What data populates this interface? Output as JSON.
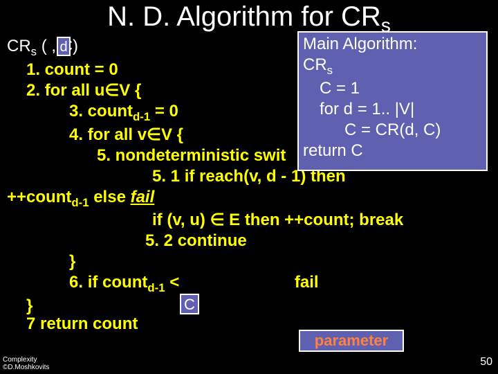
{
  "title": {
    "pre": "N. D. Algorithm for CR",
    "sub": "s"
  },
  "main_box": {
    "l1": "Main Algorithm:",
    "l2_pre": "CR",
    "l2_sub": "s",
    "l3": "C = 1",
    "l4": "for d = 1.. |V|",
    "l5": "C = CR(d, C)",
    "l6": "return C"
  },
  "box_d": "d",
  "box_c": "C",
  "box_param": "parameter",
  "code": {
    "l1_a": "CR",
    "l1_sub": "s",
    "l1_b": " (  , C)",
    "l2": "1. count = 0",
    "l3_a": "2. ",
    "l3_b": "for all",
    "l3_c": "  u",
    "l3_d": "V {",
    "l4_a": "3. count",
    "l4_sub": "d-1",
    "l4_b": " = 0",
    "l5_a": "4. ",
    "l5_b": "for all",
    "l5_c": "  v",
    "l5_d": "V {",
    "l6": "5. nondeterministic swit",
    "l7_a": "5. 1 ",
    "l7_b": "if",
    "l7_c": " reach(v, d - 1) ",
    "l7_d": "then",
    "l8_a": "++count",
    "l8_sub": "d-1",
    "l8_b": " ",
    "l8_c": "else",
    "l8_d": " ",
    "l8_e": "fail",
    "l9_a": "if",
    "l9_b": " (v, u) ",
    "l9_c": " E ",
    "l9_d": "then",
    "l9_e": " ++count; ",
    "l9_f": "break",
    "l10": "5. 2 continue",
    "l11": "}",
    "l12_a": "6. ",
    "l12_b": "if",
    "l12_c": " count",
    "l12_sub": "d-1",
    "l12_d": " <",
    "l12_e": "fail",
    "l13": "}",
    "l14": "7  return count"
  },
  "footer": {
    "l1": "Complexity",
    "l2": "©D.Moshkovits"
  },
  "page": "50"
}
